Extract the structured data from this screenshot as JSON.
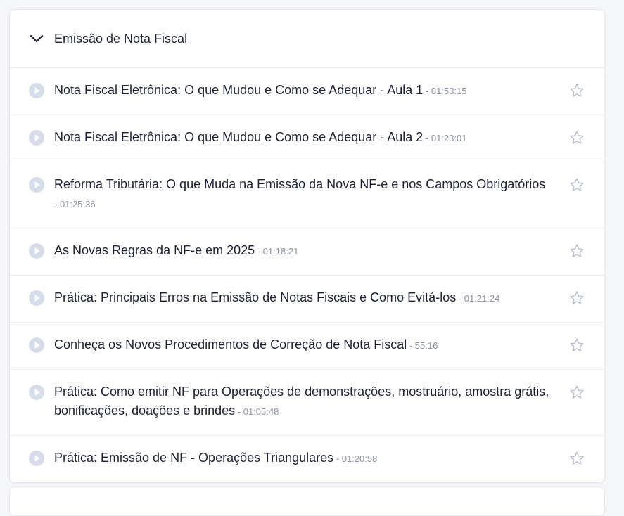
{
  "module": {
    "title": "Emissão de Nota Fiscal"
  },
  "lessons": [
    {
      "title": "Nota Fiscal Eletrônica: O que Mudou e Como se Adequar - Aula 1",
      "duration": " - 01:53:15"
    },
    {
      "title": "Nota Fiscal Eletrônica: O que Mudou e Como se Adequar - Aula 2",
      "duration": " - 01:23:01"
    },
    {
      "title": "Reforma Tributária: O que Muda na Emissão da Nova NF-e e nos Campos Obrigatórios",
      "duration": " - 01:25:36"
    },
    {
      "title": "As Novas Regras da NF-e em 2025",
      "duration": " - 01:18:21"
    },
    {
      "title": "Prática: Principais Erros na Emissão de Notas Fiscais e Como Evitá-los",
      "duration": " - 01:21:24"
    },
    {
      "title": "Conheça os Novos Procedimentos de Correção de Nota Fiscal",
      "duration": " - 55:16"
    },
    {
      "title": "Prática: Como emitir NF para Operações de demonstrações, mostruário, amostra grátis, bonificações, doações e brindes",
      "duration": " - 01:05:48"
    },
    {
      "title": "Prática: Emissão de NF - Operações Triangulares",
      "duration": " - 01:20:58"
    }
  ],
  "icons": {
    "chevron": "chevron-down-icon",
    "play": "play-circle-icon",
    "star": "star-outline-icon"
  },
  "colors": {
    "play_fill": "#d6dcea",
    "play_triangle": "#ffffff",
    "star_stroke": "#b9bfcc",
    "duration_text": "#8a90a0"
  }
}
